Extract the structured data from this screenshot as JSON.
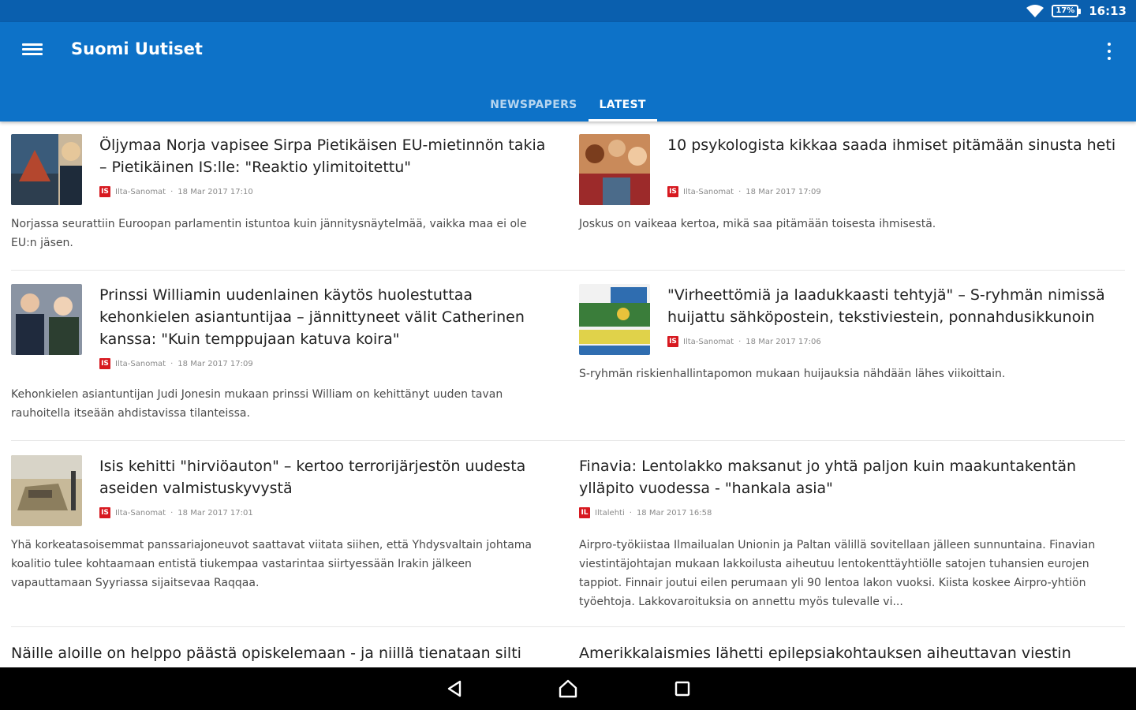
{
  "status_bar": {
    "battery": "17%",
    "time": "16:13"
  },
  "app_bar": {
    "title": "Suomi Uutiset"
  },
  "tabs": [
    {
      "label": "NEWSPAPERS",
      "active": false
    },
    {
      "label": "LATEST",
      "active": true
    }
  ],
  "articles": [
    {
      "title": "Öljymaa Norja vapisee Sirpa Pietikäisen EU-mietinnön takia – Pietikäinen IS:lle: \"Reaktio ylimitoitettu\"",
      "source": "Ilta-Sanomat",
      "date": "18 Mar 2017 17:10",
      "source_badge": "IS",
      "summary": "Norjassa seurattiin Euroopan parlamentin istuntoa kuin jännitysnäytelmää, vaikka maa ei ole EU:n jäsen."
    },
    {
      "title": "10 psykologista kikkaa saada ihmiset pitämään sinusta heti",
      "source": "Ilta-Sanomat",
      "date": "18 Mar 2017 17:09",
      "source_badge": "IS",
      "summary": "Joskus on vaikeaa kertoa, mikä saa pitämään toisesta ihmisestä."
    },
    {
      "title": "Prinssi Williamin uudenlainen käytös huolestuttaa kehonkielen asiantuntijaa – jännittyneet välit Catherinen kanssa: \"Kuin temppujaan katuva koira\"",
      "source": "Ilta-Sanomat",
      "date": "18 Mar 2017 17:09",
      "source_badge": "IS",
      "summary": "Kehonkielen asiantuntijan Judi Jonesin mukaan prinssi William on kehittänyt uuden tavan rauhoitella itseään ahdistavissa tilanteissa."
    },
    {
      "title": "\"Virheettömiä ja laadukkaasti tehtyjä\" – S-ryhmän nimissä huijattu sähköpostein, tekstiviestein, ponnahdusikkunoin",
      "source": "Ilta-Sanomat",
      "date": "18 Mar 2017 17:06",
      "source_badge": "IS",
      "summary": "S-ryhmän riskienhallintapomon mukaan huijauksia nähdään lähes viikoittain."
    },
    {
      "title": "Isis kehitti \"hirviöauton\" – kertoo terrorijärjestön uudesta aseiden valmistuskyvystä",
      "source": "Ilta-Sanomat",
      "date": "18 Mar 2017 17:01",
      "source_badge": "IS",
      "summary": "Yhä korkeatasoisemmat panssariajoneuvot saattavat viitata siihen, että Yhdysvaltain johtama koalitio tulee kohtaamaan entistä tiukempaa vastarintaa siirtyessään Irakin jälkeen vapauttamaan Syyriassa sijaitsevaa Raqqaa."
    },
    {
      "title": "Finavia: Lentolakko maksanut jo yhtä paljon kuin maakuntakentän ylläpito vuodessa - \"hankala asia\"",
      "source": "Iltalehti",
      "date": "18 Mar 2017 16:58",
      "source_badge": "IL",
      "summary": "Airpro-työkiistaa Ilmailualan Unionin ja Paltan välillä sovitellaan jälleen sunnuntaina. Finavian viestintäjohtajan mukaan lakkoilusta aiheutuu lentokenttäyhtiölle satojen tuhansien eurojen tappiot. Finnair joutui eilen perumaan yli 90 lentoa lakon vuoksi. Kiista koskee Airpro-yhtiön työehtoja. Lakkovaroituksia on annettu myös tulevalle vi..."
    },
    {
      "title": "Näille aloille on helppo päästä opiskelemaan - ja niillä tienataan silti"
    },
    {
      "title": "Amerikkalaismies lähetti epilepsiakohtauksen aiheuttavan viestin"
    }
  ],
  "colors": {
    "primary": "#0d72c8",
    "status": "#0a5fae",
    "source_red": "#d71920"
  }
}
